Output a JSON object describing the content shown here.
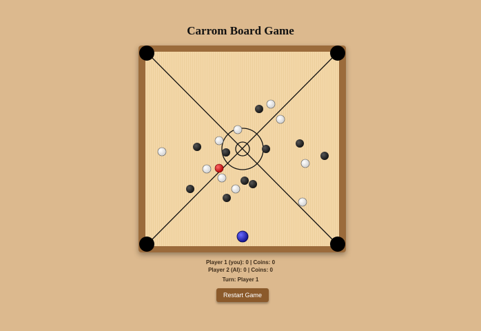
{
  "game": {
    "title": "Carrom Board Game",
    "player1_status": "Player 1 (you): 0 | Coins: 0",
    "player2_status": "Player 2 (AI): 0 | Coins: 0",
    "turn_status": "Turn: Player 1",
    "restart_label": "Restart Game"
  },
  "colors": {
    "background": "#dcb98e",
    "frame": "#9b6b3b",
    "playing_surface": "#f2d6a6",
    "pocket": "#000000",
    "black_coin": "#222222",
    "white_coin": "#f4f4f4",
    "queen": "#d41b1b",
    "striker": "#1f1fb0",
    "button": "#8b5a2b"
  },
  "pieces": {
    "striker": {
      "type": "striker",
      "color": "#1f1fb0"
    },
    "queen": {
      "type": "queen",
      "color": "#d41b1b"
    },
    "white_coins": 9,
    "black_coins": 9
  }
}
